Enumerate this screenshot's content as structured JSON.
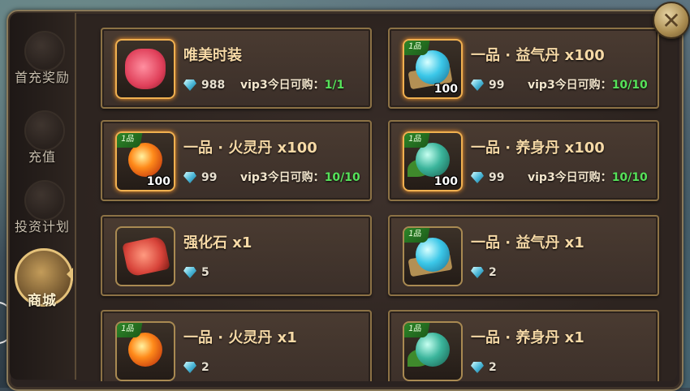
{
  "tabs": [
    {
      "label": "首充奖励",
      "icon": "bowl-icon",
      "active": false
    },
    {
      "label": "充值",
      "icon": "bowl-icon",
      "active": false
    },
    {
      "label": "投资计划",
      "icon": "chart-icon",
      "active": false
    },
    {
      "label": "商城",
      "icon": "gift-box-icon",
      "active": true
    }
  ],
  "items": [
    {
      "name": "唯美时装",
      "price": "988",
      "limit_text": "vip3今日可购：",
      "limit_count": "1/1",
      "qty": "",
      "grade": "",
      "art": "bag"
    },
    {
      "name": "一品 · 益气丹 x100",
      "price": "99",
      "limit_text": "vip3今日可购：",
      "limit_count": "10/10",
      "qty": "100",
      "grade": "1品",
      "art": "blue"
    },
    {
      "name": "一品 · 火灵丹 x100",
      "price": "99",
      "limit_text": "vip3今日可购：",
      "limit_count": "10/10",
      "qty": "100",
      "grade": "1品",
      "art": "fire"
    },
    {
      "name": "一品 · 养身丹 x100",
      "price": "99",
      "limit_text": "vip3今日可购：",
      "limit_count": "10/10",
      "qty": "100",
      "grade": "1品",
      "art": "green"
    },
    {
      "name": "强化石 x1",
      "price": "5",
      "limit_text": "",
      "limit_count": "",
      "qty": "",
      "grade": "",
      "art": "stone"
    },
    {
      "name": "一品 · 益气丹 x1",
      "price": "2",
      "limit_text": "",
      "limit_count": "",
      "qty": "",
      "grade": "1品",
      "art": "blue"
    },
    {
      "name": "一品 · 火灵丹 x1",
      "price": "2",
      "limit_text": "",
      "limit_count": "",
      "qty": "",
      "grade": "1品",
      "art": "fire"
    },
    {
      "name": "一品 · 养身丹 x1",
      "price": "2",
      "limit_text": "",
      "limit_count": "",
      "qty": "",
      "grade": "1品",
      "art": "green"
    }
  ],
  "close_label": "✕",
  "colors": {
    "gold": "#e5c27a",
    "limit_green": "#56e25a",
    "name": "#f6d9a6"
  }
}
